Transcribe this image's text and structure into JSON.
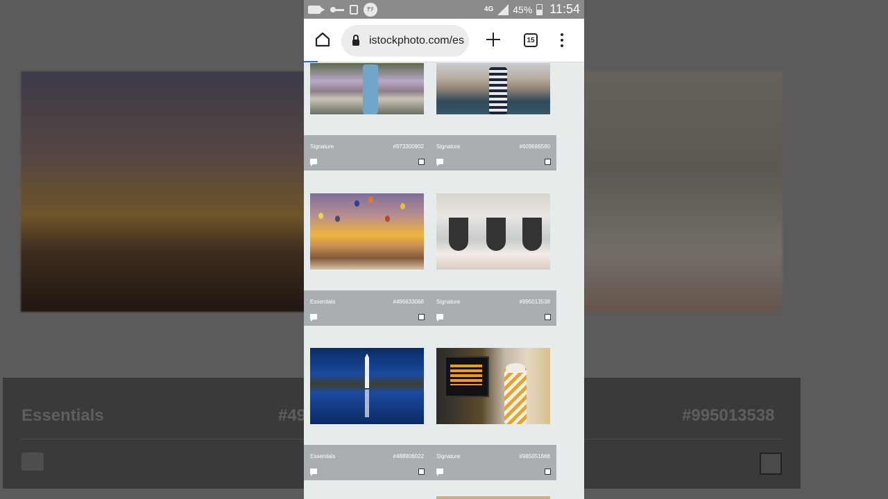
{
  "status_bar": {
    "network": "4G",
    "battery": "45%",
    "time": "11:54",
    "circle_icon_text": "۳۶"
  },
  "browser": {
    "url": "istockphoto.com/es",
    "tab_count": "15"
  },
  "cards": [
    {
      "license": "Signature",
      "id": "#973300902",
      "thumb": "garden"
    },
    {
      "license": "Signature",
      "id": "#609686580",
      "thumb": "canal"
    },
    {
      "license": "Essentials",
      "id": "#496633068",
      "thumb": "balloons"
    },
    {
      "license": "Signature",
      "id": "#995013538",
      "thumb": "hammocks"
    },
    {
      "license": "Essentials",
      "id": "#488906022",
      "thumb": "monument"
    },
    {
      "license": "Signature",
      "id": "#985051668",
      "thumb": "station"
    }
  ],
  "background": {
    "license_left": "Essentials",
    "id_left": "#49",
    "id_right": "#995013538"
  },
  "colors": {
    "status_bar": "#8a8a8a",
    "meta_bar": "#a9afb1",
    "page_bg": "#e6ebec",
    "progress": "#2a6ad8"
  }
}
